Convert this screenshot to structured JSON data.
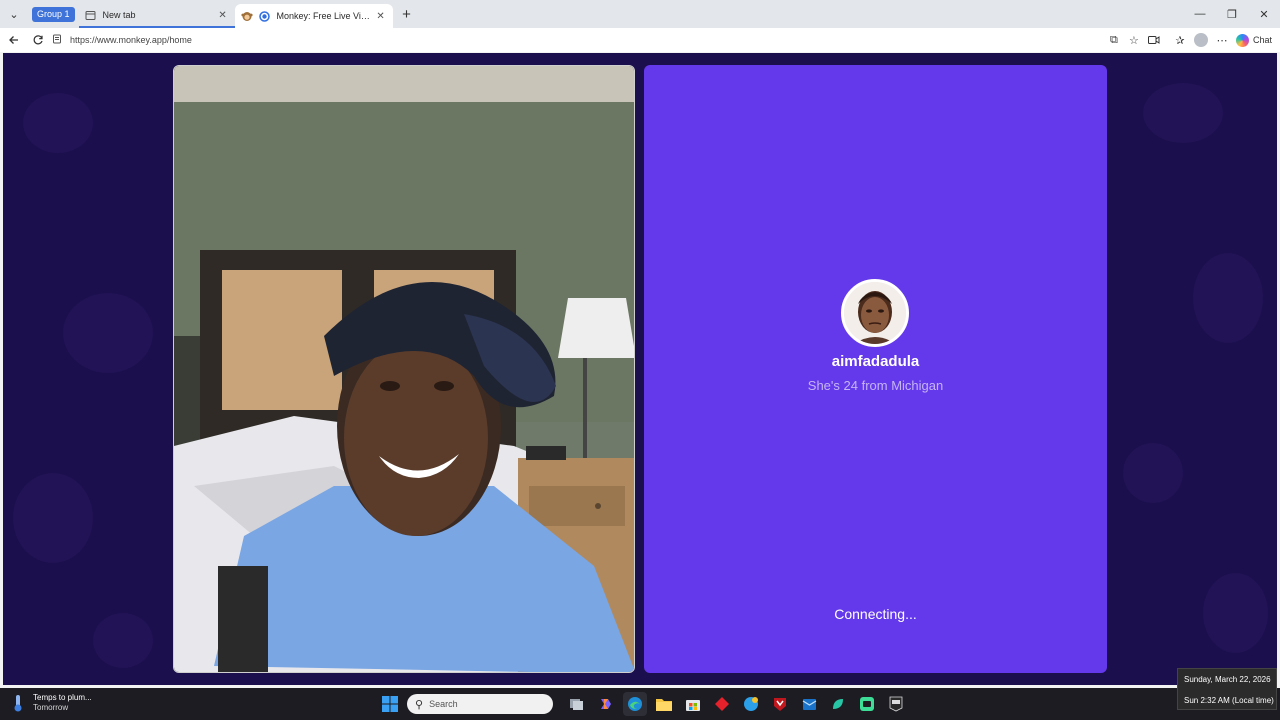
{
  "browser": {
    "group_label": "Group 1",
    "tabs": [
      {
        "title": "New tab",
        "close": "✕"
      },
      {
        "title": "Monkey: Free Live Video Chat",
        "close": "✕"
      }
    ],
    "new_tab": "+",
    "window_controls": {
      "minimize": "—",
      "restore": "❐",
      "close": "✕"
    },
    "address": "https://www.monkey.app/home",
    "copilot_label": "Chat",
    "icons": [
      "back-icon",
      "reload-icon",
      "lock-icon",
      "split-screen-icon",
      "favorite-star-icon",
      "video-icon",
      "favorites-bar-icon",
      "profile-icon",
      "more-icon",
      "copilot-icon"
    ]
  },
  "page": {
    "remote": {
      "username": "aimfadadula",
      "subtitle": "She's 24 from Michigan",
      "status": "Connecting..."
    },
    "colors": {
      "background": "#1c0f4d",
      "remote_card": "#6438eb"
    }
  },
  "taskbar": {
    "weather": {
      "line1": "Temps to plum...",
      "line2": "Tomorrow"
    },
    "search_placeholder": "Search",
    "apps": [
      "windows-start-icon",
      "search-icon",
      "task-view-icon",
      "copilot-app-icon",
      "edge-icon",
      "file-explorer-icon",
      "microsoft-store-icon",
      "red-app-icon",
      "edge-beta-icon",
      "mcafee-icon",
      "outlook-icon",
      "teal-app-icon",
      "green-app-icon",
      "epic-games-icon"
    ],
    "tray_icons": [
      "chevron-up-icon",
      "onedrive-icon",
      "wifi-icon"
    ],
    "clock_date": "Sunday, March 22, 2026",
    "clock_time": "Sun 2:32 AM (Local time)"
  }
}
